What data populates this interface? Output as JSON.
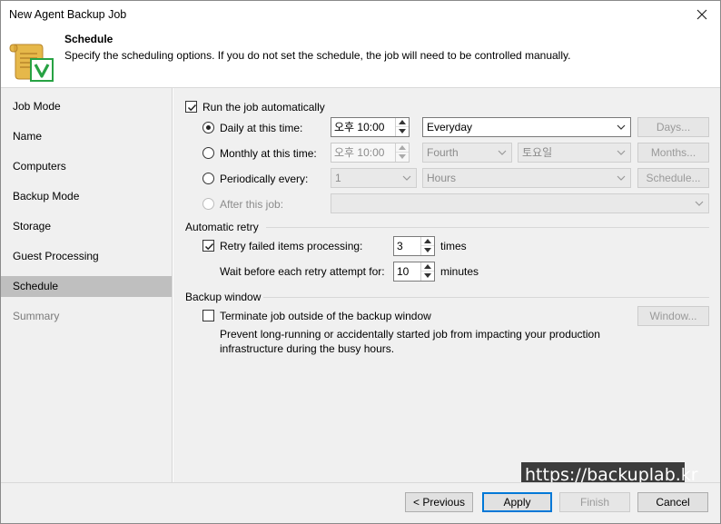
{
  "window": {
    "title": "New Agent Backup Job"
  },
  "header": {
    "title": "Schedule",
    "description": "Specify the scheduling options. If you do not set the schedule, the job will need to be controlled manually."
  },
  "sidebar": {
    "items": [
      {
        "label": "Job Mode",
        "state": "normal"
      },
      {
        "label": "Name",
        "state": "normal"
      },
      {
        "label": "Computers",
        "state": "normal"
      },
      {
        "label": "Backup Mode",
        "state": "normal"
      },
      {
        "label": "Storage",
        "state": "normal"
      },
      {
        "label": "Guest Processing",
        "state": "normal"
      },
      {
        "label": "Schedule",
        "state": "active"
      },
      {
        "label": "Summary",
        "state": "disabled"
      }
    ]
  },
  "schedule": {
    "run_auto_label": "Run the job automatically",
    "run_auto_checked": true,
    "daily": {
      "label": "Daily at this time:",
      "selected": true,
      "time": "오후 10:00",
      "period": "Everyday",
      "button": "Days..."
    },
    "monthly": {
      "label": "Monthly at this time:",
      "selected": false,
      "time": "오후 10:00",
      "week": "Fourth",
      "day": "토요일",
      "button": "Months..."
    },
    "periodic": {
      "label": "Periodically every:",
      "selected": false,
      "value": "1",
      "unit": "Hours",
      "button": "Schedule..."
    },
    "after": {
      "label": "After this job:",
      "selected": false,
      "value": ""
    }
  },
  "retry": {
    "group_title": "Automatic retry",
    "retry_label": "Retry failed items processing:",
    "retry_checked": true,
    "retry_count": "3",
    "times_label": "times",
    "wait_label": "Wait before each retry attempt for:",
    "wait_value": "10",
    "minutes_label": "minutes"
  },
  "backup_window": {
    "group_title": "Backup window",
    "terminate_label": "Terminate job outside of the backup window",
    "terminate_checked": false,
    "button": "Window...",
    "description_line1": "Prevent long-running or accidentally started job from impacting your production",
    "description_line2": "infrastructure during the busy hours."
  },
  "footer": {
    "previous": "< Previous",
    "apply": "Apply",
    "finish": "Finish",
    "cancel": "Cancel"
  },
  "watermark": "https://backuplab.kr",
  "icons": {
    "close": "close-icon",
    "header": "scroll-checkmark-icon",
    "checkmark": "checkmark-icon",
    "dropdown": "chevron-down-icon"
  }
}
